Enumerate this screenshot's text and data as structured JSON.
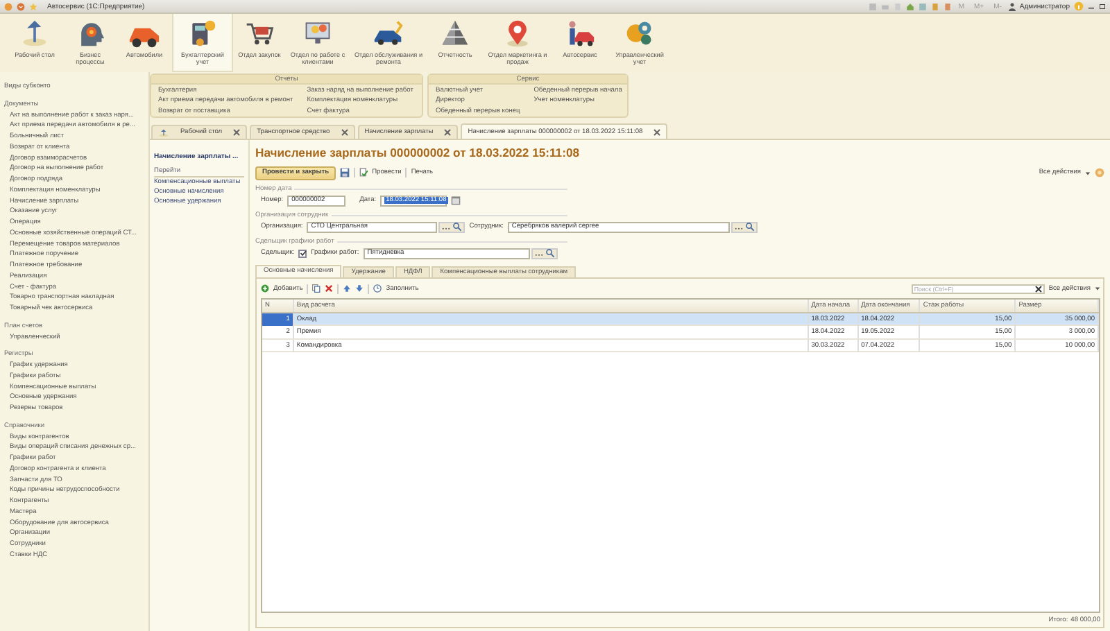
{
  "window": {
    "title": "Автосервис  (1С:Предприятие)",
    "memory_buttons": [
      "M",
      "M+",
      "M-"
    ],
    "user": "Администратор"
  },
  "sections": [
    {
      "label": "Рабочий стол",
      "selected": false
    },
    {
      "label": "Бизнес процессы",
      "selected": false
    },
    {
      "label": "Автомобили",
      "selected": false
    },
    {
      "label": "Бухгалтерский учет",
      "selected": true
    },
    {
      "label": "Отдел закупок",
      "selected": false
    },
    {
      "label": "Отдел по работе с клиентами",
      "selected": false
    },
    {
      "label": "Отдел обслуживания и ремонта",
      "selected": false
    },
    {
      "label": "Отчетность",
      "selected": false
    },
    {
      "label": "Отдел маркетинга и продаж",
      "selected": false
    },
    {
      "label": "Автосервис",
      "selected": false
    },
    {
      "label": "Управленческий учет",
      "selected": false
    }
  ],
  "function_panel": [
    {
      "title": "Отчеты",
      "columns": [
        [
          "Бухгалтерия",
          "Акт приема передачи автомобиля в ремонт",
          "Возврат от поставщика"
        ],
        [
          "Заказ наряд на выполнение работ",
          "Комплектация номенклатуры",
          "Счет фактура"
        ]
      ]
    },
    {
      "title": "Сервис",
      "columns": [
        [
          "Валютный учет",
          "Директор",
          "Обеденный перерыв конец"
        ],
        [
          "Обеденный перерыв начала",
          "Учет номенклатуры"
        ]
      ]
    }
  ],
  "sidebar": {
    "top_item": "Виды субконто",
    "groups": [
      {
        "title": "Документы",
        "items": [
          "Акт на выполнение работ к заказ наря...",
          "Акт приема передачи автомобиля в ре...",
          "Больничный лист",
          "Возврат от клиента",
          "Договор взаиморасчетов",
          "Договор на выполнение работ",
          "Договор подряда",
          "Комплектация номенклатуры",
          "Начисление зарплаты",
          "Оказание услуг",
          "Операция",
          "Основные хозяйственные операций СТ...",
          "Перемещение товаров материалов",
          "Платежное поручение",
          "Платежное требование",
          "Реализация",
          "Счет - фактура",
          "Товарно транспортная накладная",
          "Товарный чек автосервиса"
        ]
      },
      {
        "title": "План счетов",
        "items": [
          "Управленческий"
        ]
      },
      {
        "title": "Регистры",
        "items": [
          "График удержания",
          "Графики работы",
          "Компенсационные выплаты",
          "Основные удержания",
          "Резервы товаров"
        ]
      },
      {
        "title": "Справочники",
        "items": [
          "Виды контрагентов",
          "Виды операций списания денежных ср...",
          "Графики работ",
          "Договор контрагента и клиента",
          "Запчасти для ТО",
          "Коды причины нетрудоспособности",
          "Контрагенты",
          "Мастера",
          "Оборудование для автосервиса",
          "Организации",
          "Сотрудники",
          "Ставки НДС"
        ]
      }
    ]
  },
  "open_tabs": [
    {
      "label": "Рабочий стол",
      "selected": false
    },
    {
      "label": "Транспортное средство",
      "selected": false
    },
    {
      "label": "Начисление зарплаты",
      "selected": false
    },
    {
      "label": "Начисление зарплаты 000000002 от 18.03.2022 15:11:08",
      "selected": true
    }
  ],
  "doc_nav": {
    "title": "Начисление зарплаты ...",
    "goto": "Перейти",
    "items": [
      "Компенсационные выплаты",
      "Основные начисления",
      "Основные удержания"
    ]
  },
  "form": {
    "title": "Начисление зарплаты 000000002 от 18.03.2022 15:11:08",
    "toolbar": {
      "primary": "Провести и закрыть",
      "post": "Провести",
      "print": "Печать",
      "all_actions": "Все действия"
    },
    "number_group": {
      "title": "Номер дата",
      "number_label": "Номер:",
      "number": "000000002",
      "date_label": "Дата:",
      "date": "18.03.2022 15:11:08",
      "date_text_selected": true
    },
    "org_group": {
      "title": "Организация сотрудник",
      "org_label": "Организация:",
      "org": "СТО Центральная",
      "employee_label": "Сотрудник:",
      "employee": "Серебряков валерий сергее"
    },
    "piece_group": {
      "title": "Сдельщик графики работ",
      "piece_label": "Сдельщик:",
      "piece_checked": true,
      "schedule_label": "Графики работ:",
      "schedule": "Пятидневка"
    },
    "tabs": [
      {
        "label": "Основные начисления",
        "selected": true
      },
      {
        "label": "Удержание",
        "selected": false
      },
      {
        "label": "НДФЛ",
        "selected": false
      },
      {
        "label": "Компенсационные выплаты сотрудникам",
        "selected": false
      }
    ],
    "table_toolbar": {
      "add": "Добавить",
      "fill": "Заполнить",
      "search_placeholder": "Поиск (Ctrl+F)",
      "all_actions": "Все действия"
    },
    "table": {
      "columns": [
        "N",
        "Вид расчета",
        "Дата начала",
        "Дата окончания",
        "Стаж работы",
        "Размер"
      ],
      "rows": [
        {
          "cells": [
            "1",
            "Оклад",
            "18.03.2022",
            "18.04.2022",
            "15,00",
            "35 000,00"
          ],
          "selected": true
        },
        {
          "cells": [
            "2",
            "Премия",
            "18.04.2022",
            "19.05.2022",
            "15,00",
            "3 000,00"
          ],
          "selected": false
        },
        {
          "cells": [
            "3",
            "Командировка",
            "30.03.2022",
            "07.04.2022",
            "15,00",
            "10 000,00"
          ],
          "selected": false
        }
      ]
    },
    "total": {
      "label": "Итого:",
      "value": "48 000,00"
    }
  }
}
